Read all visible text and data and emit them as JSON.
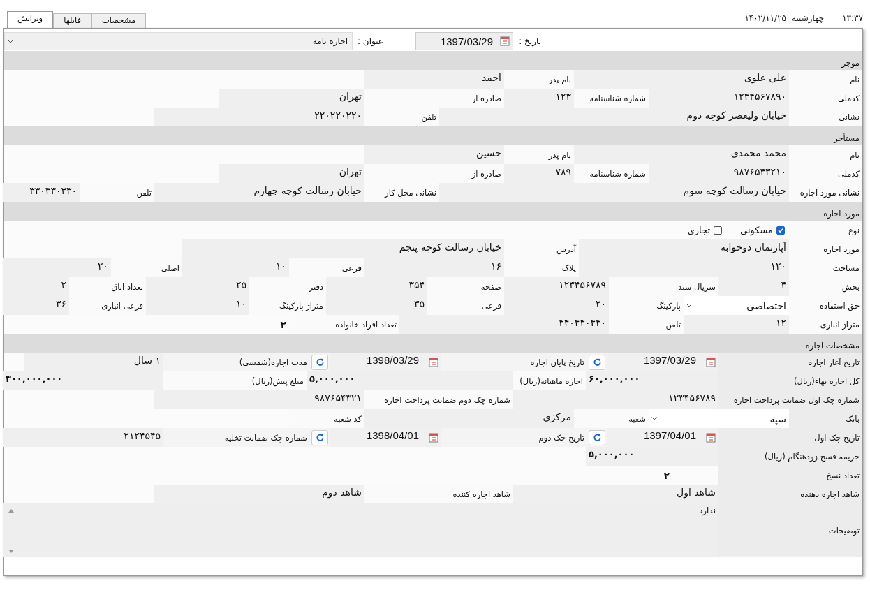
{
  "clock": {
    "time": "۱۳:۳۷",
    "day": "چهارشنبه",
    "date": "۱۴۰۲/۱۱/۲۵"
  },
  "tabs": [
    {
      "label": "مشخصات",
      "selected": false
    },
    {
      "label": "فایلها",
      "selected": false
    },
    {
      "label": "ویرایش",
      "selected": true
    }
  ],
  "header": {
    "date_label": "تاریخ :",
    "date": "1397/03/29",
    "title_label": "عنوان :",
    "title": "اجاره نامه"
  },
  "sections": [
    {
      "title": "موجر",
      "rows": [
        {
          "fields": [
            {
              "label": "نام",
              "kind": "text",
              "value": "علی علوی"
            },
            {
              "label": "نام پدر",
              "kind": "text",
              "value": "احمد"
            }
          ]
        },
        {
          "fields": [
            {
              "label": "کدملی",
              "kind": "text",
              "value": "۱۲۳۴۵۶۷۸۹۰"
            },
            {
              "label": "شماره شناسنامه",
              "kind": "text",
              "value": "۱۲۳"
            },
            {
              "label": "صادره از",
              "kind": "text",
              "value": "تهران"
            }
          ]
        },
        {
          "fields": [
            {
              "label": "نشانی",
              "kind": "text",
              "value": "خیابان ولیعصر کوچه دوم"
            },
            {
              "label": "تلفن",
              "kind": "text",
              "value": "۲۲۰۲۲۰۲۲۰"
            }
          ]
        }
      ]
    },
    {
      "title": "مستأجر",
      "rows": [
        {
          "fields": [
            {
              "label": "نام",
              "kind": "text",
              "value": "محمد محمدی"
            },
            {
              "label": "نام پدر",
              "kind": "text",
              "value": "حسین"
            }
          ]
        },
        {
          "fields": [
            {
              "label": "کدملی",
              "kind": "text",
              "value": "۹۸۷۶۵۴۳۲۱۰"
            },
            {
              "label": "شماره شناسنامه",
              "kind": "text",
              "value": "۷۸۹"
            },
            {
              "label": "صادره از",
              "kind": "text",
              "value": "تهران"
            }
          ]
        },
        {
          "fields": [
            {
              "label": "نشانی مورد اجاره",
              "kind": "text",
              "value": "خیابان رسالت کوچه سوم"
            },
            {
              "label": "نشانی محل کار",
              "kind": "text",
              "value": "خیابان رسالت کوچه چهارم"
            },
            {
              "label": "تلفن",
              "kind": "text",
              "value": "۳۳۰۳۳۰۳۳۰"
            }
          ]
        }
      ]
    },
    {
      "title": "مورد اجاره",
      "rows": [
        {
          "fields": [
            {
              "label": "نوع",
              "kind": "checks",
              "options": [
                {
                  "text": "مسکونی",
                  "checked": true
                },
                {
                  "text": "تجاری",
                  "checked": false
                }
              ]
            }
          ]
        },
        {
          "fields": [
            {
              "label": "مورد اجاره",
              "kind": "text",
              "value": "آپارتمان دوخوابه"
            },
            {
              "label": "آدرس",
              "kind": "text",
              "value": "خیابان رسالت کوچه پنجم"
            }
          ]
        },
        {
          "fields": [
            {
              "label": "مساحت",
              "kind": "text",
              "value": "۱۲۰"
            },
            {
              "label": "پلاک",
              "kind": "text",
              "value": "۱۶"
            },
            {
              "label": "فرعی",
              "kind": "text",
              "value": "۱۰"
            },
            {
              "label": "اصلی",
              "kind": "text",
              "value": "۲۰"
            }
          ]
        },
        {
          "fields": [
            {
              "label": "بخش",
              "kind": "text",
              "value": "۴"
            },
            {
              "label": "سریال سند",
              "kind": "text",
              "value": "۱۲۳۴۵۶۷۸۹"
            },
            {
              "label": "صفحه",
              "kind": "text",
              "value": "۳۵۴"
            },
            {
              "label": "دفتر",
              "kind": "text",
              "value": "۲۵"
            },
            {
              "label": "تعداد اتاق",
              "kind": "text",
              "value": "۲"
            }
          ]
        },
        {
          "fields": [
            {
              "label": "حق استفاده",
              "kind": "select",
              "value": "اختصاصی"
            },
            {
              "label": "پارکینگ",
              "kind": "text",
              "value": "۲۰"
            },
            {
              "label": "فرعی",
              "kind": "text",
              "value": "۳۵"
            },
            {
              "label": "متراژ پارکینگ",
              "kind": "text",
              "value": "۱۰"
            },
            {
              "label": "فرعی انباری",
              "kind": "text",
              "value": "۳۶"
            }
          ]
        },
        {
          "fields": [
            {
              "label": "متراژ انباری",
              "kind": "text",
              "value": "۱۲"
            },
            {
              "label": "تلفن",
              "kind": "text",
              "value": "۴۴۰۴۴۰۴۴۰"
            },
            {
              "label": "تعداد افراد خانواده",
              "kind": "bold",
              "value": "۲"
            }
          ]
        }
      ]
    },
    {
      "title": "مشخصات اجاره",
      "rows": [
        {
          "fields": [
            {
              "label": "تاریخ آغاز اجاره",
              "kind": "date",
              "value": "1397/03/29"
            },
            {
              "label": "تاریخ پایان اجاره",
              "kind": "date",
              "value": "1398/03/29"
            },
            {
              "label": "مدت اجاره(شمسی)",
              "kind": "text",
              "value": "۱ سال"
            }
          ]
        },
        {
          "fields": [
            {
              "label": "کل اجاره بهاء(ریال)",
              "kind": "amount",
              "value": "۶۰,۰۰۰,۰۰۰"
            },
            {
              "label": "اجاره ماهیانه(ریال)",
              "kind": "amount",
              "value": "۵,۰۰۰,۰۰۰"
            },
            {
              "label": "مبلغ پیش(ریال)",
              "kind": "amount",
              "value": "۳۰۰,۰۰۰,۰۰۰"
            }
          ]
        },
        {
          "fields": [
            {
              "label": "شماره چک اول ضمانت پرداخت اجاره",
              "kind": "text",
              "value": "۱۲۳۴۵۶۷۸۹"
            },
            {
              "label": "شماره چک دوم ضمانت پرداخت اجاره",
              "kind": "text",
              "value": "۹۸۷۶۵۴۳۲۱"
            }
          ]
        },
        {
          "fields": [
            {
              "label": "بانک",
              "kind": "select",
              "value": "سپه"
            },
            {
              "label": "شعبه",
              "kind": "text",
              "value": "مرکزی"
            },
            {
              "label": "کد شعبه",
              "kind": "empty"
            }
          ]
        },
        {
          "fields": [
            {
              "label": "تاریخ چک اول",
              "kind": "date",
              "value": "1397/04/01"
            },
            {
              "label": "تاریخ چک دوم",
              "kind": "date",
              "value": "1398/04/01"
            },
            {
              "label": "شماره چک ضمانت تخلیه",
              "kind": "text",
              "value": "۲۱۲۴۵۴۵"
            }
          ]
        },
        {
          "fields": [
            {
              "label": "جریمه فسخ زودهنگام (ریال)",
              "kind": "amount",
              "value": "۵,۰۰۰,۰۰۰"
            }
          ]
        },
        {
          "fields": [
            {
              "label": "تعداد نسخ",
              "kind": "bold",
              "value": "۲"
            }
          ]
        },
        {
          "fields": [
            {
              "label": "شاهد اجاره دهنده",
              "kind": "text",
              "value": "شاهد اول"
            },
            {
              "label": "شاهد اجاره کننده",
              "kind": "text",
              "value": "شاهد دوم"
            }
          ]
        },
        {
          "fields": [
            {
              "label": "توضیحات",
              "kind": "textarea",
              "value": "ندارد"
            }
          ]
        }
      ]
    }
  ]
}
